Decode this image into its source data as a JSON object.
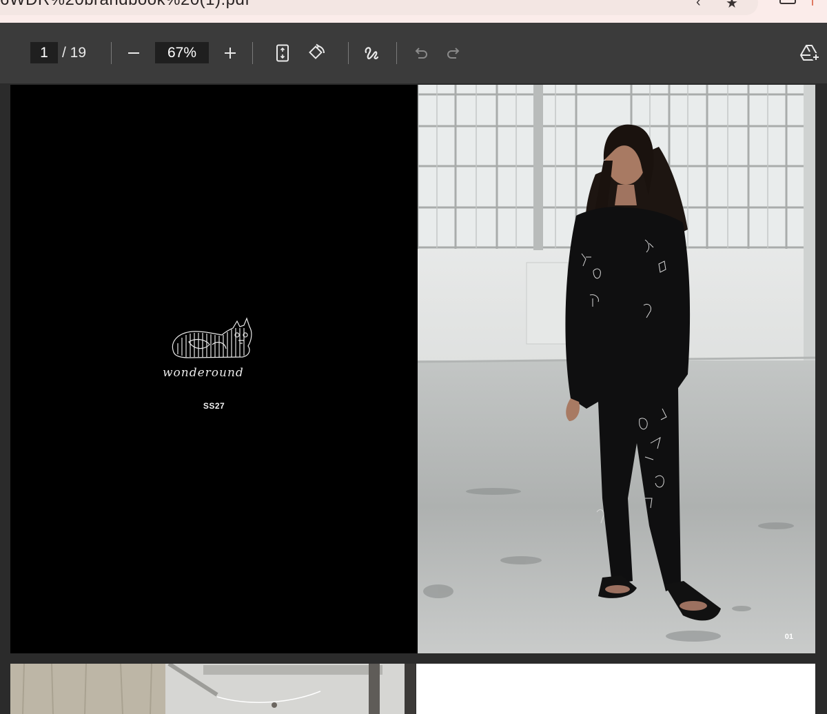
{
  "browser": {
    "url_fragment": "6WDR%20brandbook%20(1).pdf"
  },
  "toolbar": {
    "current_page": "1",
    "page_total": "/ 19",
    "zoom_level": "67%"
  },
  "icons": [
    "back-icon",
    "star-icon",
    "tab-icon",
    "zoom-out-icon",
    "zoom-in-icon",
    "fit-page-icon",
    "rotate-icon",
    "annotate-icon",
    "undo-icon",
    "redo-icon",
    "drive-add-icon"
  ],
  "document": {
    "page1": {
      "brand_logo_text": "wonderound",
      "season": "SS27",
      "page_number": "01"
    }
  }
}
